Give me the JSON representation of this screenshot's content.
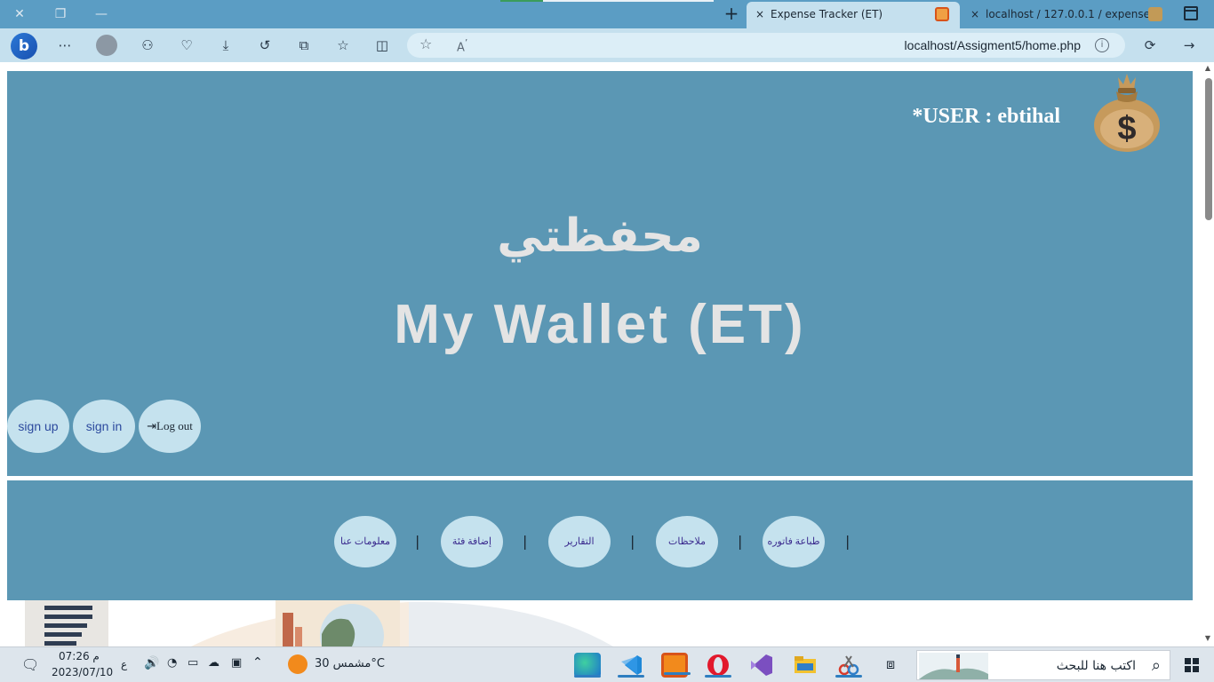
{
  "browser": {
    "tabs": [
      {
        "title": "Expense Tracker (ET)",
        "active": true
      },
      {
        "title": "localhost / 127.0.0.1 / expenses",
        "active": false
      }
    ],
    "load_progress": 0.2,
    "address": "localhost/Assigment5/home.php",
    "new_tab_symbol": "+",
    "close_symbol": "×"
  },
  "page": {
    "user_label": "*USER : ebtihal",
    "title_ar": "محفظتي",
    "title_en": "My Wallet (ET)",
    "auth_buttons": {
      "signup": "sign up",
      "signin": "sign in",
      "logout": "Log out",
      "logout_icon": "logout-icon"
    },
    "nav": [
      "طباعة فاتوره",
      "ملاحظات",
      "التقارير",
      "إضافة فئة",
      "معلومات عنا"
    ],
    "separator": "|"
  },
  "taskbar": {
    "time": "07:26 م",
    "date": "2023/07/10",
    "lang": "ع",
    "weather": "مشمس  30°C",
    "search_placeholder": "اكتب هنا للبحث"
  },
  "colors": {
    "panel": "#5b97b4",
    "button": "#c5e2ee",
    "tab_bar": "#5b9dc4",
    "toolbar": "#c5e0ee"
  }
}
